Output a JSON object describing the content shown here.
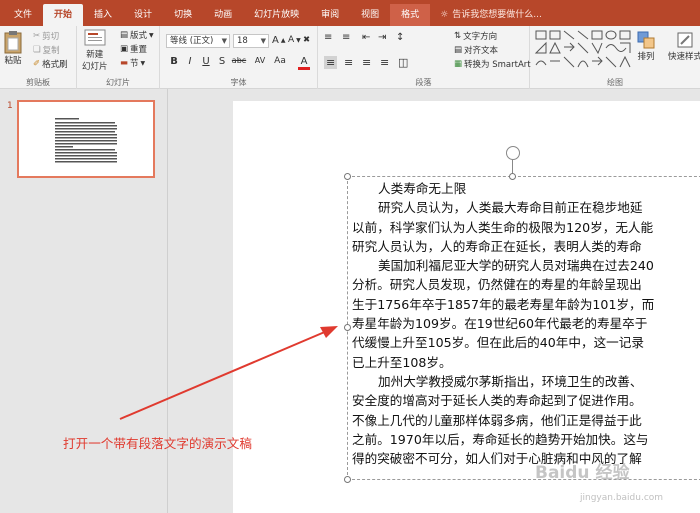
{
  "tabs": [
    {
      "label": "文件",
      "state": "normal"
    },
    {
      "label": "开始",
      "state": "active"
    },
    {
      "label": "插入",
      "state": "normal"
    },
    {
      "label": "设计",
      "state": "normal"
    },
    {
      "label": "切换",
      "state": "normal"
    },
    {
      "label": "动画",
      "state": "normal"
    },
    {
      "label": "幻灯片放映",
      "state": "normal"
    },
    {
      "label": "审阅",
      "state": "normal"
    },
    {
      "label": "视图",
      "state": "normal"
    },
    {
      "label": "格式",
      "state": "format"
    }
  ],
  "tellme": "告诉我您想要做什么...",
  "ribbon": {
    "clipboard": {
      "label": "剪贴板",
      "paste": "粘贴",
      "cut": "剪切",
      "copy": "复制",
      "painter": "格式刷"
    },
    "slides": {
      "label": "幻灯片",
      "new_slide": "新建",
      "new_slide2": "幻灯片",
      "layout": "版式",
      "reset": "重置",
      "section": "节"
    },
    "font": {
      "label": "字体",
      "family": "等线 (正文)",
      "size": "18",
      "bold": "B",
      "italic": "I",
      "underline": "U",
      "shadow": "S",
      "strike": "abc",
      "spacing": "AV",
      "case": "Aa",
      "color_a": "A"
    },
    "paragraph": {
      "label": "段落",
      "text_direction": "文字方向",
      "align_text": "对齐文本",
      "smartart": "转换为 SmartArt"
    },
    "drawing": {
      "label": "绘图",
      "arrange": "排列",
      "quick_styles": "快速样式"
    }
  },
  "thumbnail": {
    "number": "1"
  },
  "slide_text": {
    "title": "人类寿命无上限",
    "lines": [
      {
        "text": "研究人员认为，人类最大寿命目前正在稳步地延",
        "indent": true
      },
      {
        "text": "以前，科学家们认为人类生命的极限为120岁，无人能",
        "indent": false
      },
      {
        "text": "研究人员认为，人的寿命正在延长，表明人类的寿命",
        "indent": false
      },
      {
        "text": "美国加利福尼亚大学的研究人员对瑞典在过去240",
        "indent": true
      },
      {
        "text": "分析。研究人员发现，仍然健在的寿星的年龄呈现出",
        "indent": false
      },
      {
        "text": "生于1756年卒于1857年的最老寿星年龄为101岁，而",
        "indent": false
      },
      {
        "text": "寿星年龄为109岁。在19世纪60年代最老的寿星卒于",
        "indent": false
      },
      {
        "text": "代缓慢上升至105岁。但在此后的40年中，这一记录",
        "indent": false
      },
      {
        "text": "已上升至108岁。",
        "indent": false
      },
      {
        "text": "加州大学教授威尔茅斯指出，环境卫生的改善、",
        "indent": true
      },
      {
        "text": "安全度的增高对于延长人类的寿命起到了促进作用。",
        "indent": false
      },
      {
        "text": "不像上几代的儿童那样体弱多病，他们正是得益于此",
        "indent": false
      },
      {
        "text": "之前。1970年以后，寿命延长的趋势开始加快。这与",
        "indent": false
      },
      {
        "text": "得的突破密不可分，如人们对于心脏病和中风的了解",
        "indent": false
      }
    ]
  },
  "annotation": "打开一个带有段落文字的演示文稿",
  "watermark": "Baidu 经验",
  "watermark_sub": "jingyan.baidu.com",
  "colors": {
    "accent": "#b7472a",
    "annotation": "#e03a2f"
  }
}
